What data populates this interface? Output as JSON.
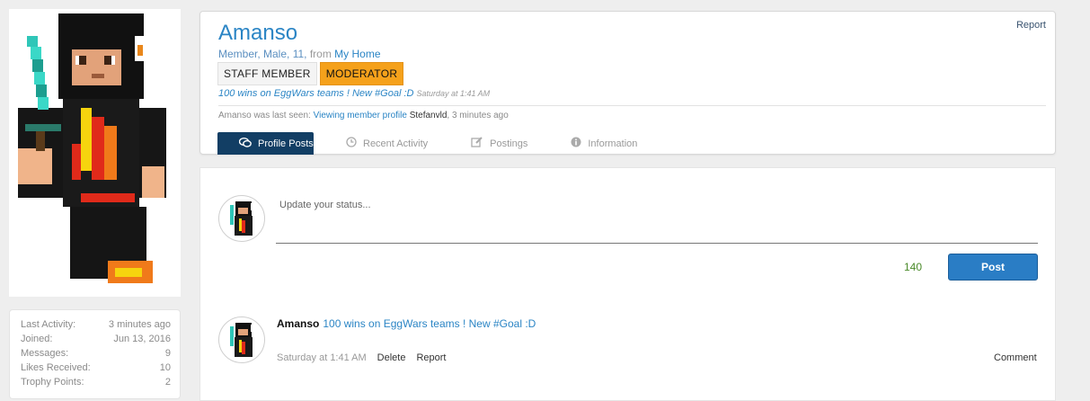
{
  "stats": [
    {
      "label": "Last Activity:",
      "value": "3 minutes ago"
    },
    {
      "label": "Joined:",
      "value": "Jun 13, 2016"
    },
    {
      "label": "Messages:",
      "value": "9"
    },
    {
      "label": "Likes Received:",
      "value": "10"
    },
    {
      "label": "Trophy Points:",
      "value": "2"
    }
  ],
  "profile": {
    "report_label": "Report",
    "username": "Amanso",
    "info_prefix": "Member, Male, 11,",
    "info_from": "from",
    "info_home": "My Home",
    "banners": [
      "STAFF MEMBER",
      "MODERATOR"
    ],
    "status_text": "100 wins on EggWars teams ! New #Goal :D",
    "status_time": "Saturday at 1:41 AM",
    "last_seen_prefix": "Amanso was last seen:",
    "last_seen_activity": "Viewing member profile",
    "last_seen_who": "Stefanvld",
    "last_seen_time": ", 3 minutes ago",
    "tabs": [
      {
        "label": "Profile Posts",
        "icon": "speech-bubbles-icon"
      },
      {
        "label": "Recent Activity",
        "icon": "clock-icon"
      },
      {
        "label": "Postings",
        "icon": "edit-icon"
      },
      {
        "label": "Information",
        "icon": "info-icon"
      }
    ]
  },
  "compose": {
    "placeholder": "Update your status...",
    "counter": "140",
    "post_label": "Post"
  },
  "post": {
    "author": "Amanso",
    "text": "100 wins on EggWars teams ! New #Goal :D",
    "time": "Saturday at 1:41 AM",
    "delete_label": "Delete",
    "report_label": "Report",
    "comment_label": "Comment"
  },
  "colors": {
    "link_blue": "#2b85c5",
    "tab_active": "#123e64",
    "moderator_banner": "#f5a11b",
    "post_button": "#2a7dc5"
  }
}
